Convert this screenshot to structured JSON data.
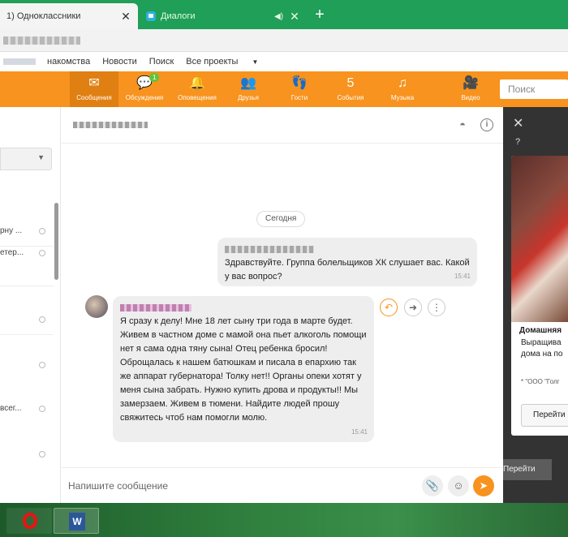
{
  "browser": {
    "tabs": [
      {
        "title": "1) Одноклассники",
        "close": "✕"
      },
      {
        "title": "Диалоги",
        "sound": "◀)",
        "close": "✕"
      }
    ],
    "new_tab": "+"
  },
  "toplinks": [
    "накомства",
    "Новости",
    "Поиск",
    "Все проекты"
  ],
  "nav": {
    "items": [
      {
        "label": "Сообщения",
        "icon": "envelope-icon",
        "glyph": "✉"
      },
      {
        "label": "Обсуждения",
        "icon": "chat-bubbles-icon",
        "glyph": "💬",
        "badge": "1"
      },
      {
        "label": "Оповещения",
        "icon": "bell-icon",
        "glyph": "🔔"
      },
      {
        "label": "Друзья",
        "icon": "friends-icon",
        "glyph": "👥"
      },
      {
        "label": "Гости",
        "icon": "footprints-icon",
        "glyph": "👣"
      },
      {
        "label": "События",
        "icon": "events-icon",
        "glyph": "5"
      },
      {
        "label": "Музыка",
        "icon": "music-icon",
        "glyph": "♫"
      },
      {
        "label": "Видео",
        "icon": "video-icon",
        "glyph": "🎥"
      }
    ],
    "search_placeholder": "Поиск"
  },
  "sidebar": {
    "previews": [
      "рну ...",
      "етер...",
      "",
      "",
      "всег...",
      "",
      ""
    ]
  },
  "chat": {
    "date": "Сегодня",
    "messages": [
      {
        "direction": "out",
        "text": "Здравствуйте. Группа болельщиков ХК  слушает вас. Какой у вас вопрос?",
        "time": "15:41"
      },
      {
        "direction": "in",
        "text": "Я сразу к делу! Мне 18 лет сыну три года в марте будет. Живем в частном доме с мамой она пьет алкоголь помощи нет я сама одна тяну сына! Отец ребенка бросил! Оброщалась к нашем батюшкам и писала в епархию так же аппарат губернатора! Толку нет!! Органы опеки хотят у меня сына забрать. Нужно купить дрова и продукты!! Мы замерзаем. Живем в тюмени. Найдите людей прошу свяжитесь чтоб нам помогли молю.",
        "time": "15:41"
      }
    ],
    "composer_placeholder": "Напишите сообщение"
  },
  "ad": {
    "close": "✕",
    "help": "?",
    "title": "Домашняя",
    "text_lines": [
      "Выращива",
      "дома на по"
    ],
    "source": "* \"ООО \"Голг",
    "button": "Перейти",
    "button2": "Перейти"
  },
  "colors": {
    "ok_orange": "#f7931e",
    "browser_green": "#1f9f57",
    "bubble_gray": "#eeeeee"
  }
}
